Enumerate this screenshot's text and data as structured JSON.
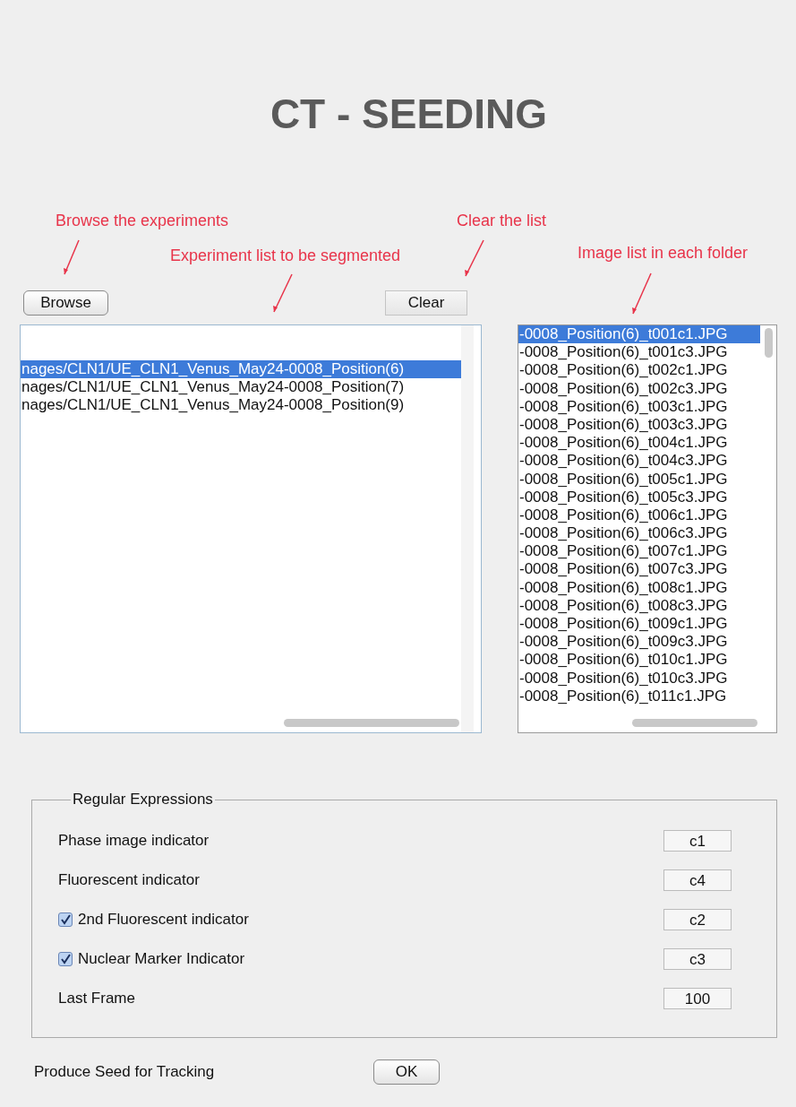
{
  "title": "CT - SEEDING",
  "annotations": [
    {
      "text": "Browse the experiments"
    },
    {
      "text": "Experiment list to be segmented"
    },
    {
      "text": "Clear the list"
    },
    {
      "text": "Image list in each folder"
    }
  ],
  "browse_button": "Browse",
  "clear_button": "Clear",
  "experiment_list": {
    "items": [
      {
        "text": "nages/CLN1/UE_CLN1_Venus_May24-0008_Position(6)",
        "selected": true
      },
      {
        "text": "nages/CLN1/UE_CLN1_Venus_May24-0008_Position(7)",
        "selected": false
      },
      {
        "text": "nages/CLN1/UE_CLN1_Venus_May24-0008_Position(9)",
        "selected": false
      }
    ]
  },
  "image_list": {
    "items": [
      {
        "text": "-0008_Position(6)_t001c1.JPG",
        "selected": true
      },
      {
        "text": "-0008_Position(6)_t001c3.JPG",
        "selected": false
      },
      {
        "text": "-0008_Position(6)_t002c1.JPG",
        "selected": false
      },
      {
        "text": "-0008_Position(6)_t002c3.JPG",
        "selected": false
      },
      {
        "text": "-0008_Position(6)_t003c1.JPG",
        "selected": false
      },
      {
        "text": "-0008_Position(6)_t003c3.JPG",
        "selected": false
      },
      {
        "text": "-0008_Position(6)_t004c1.JPG",
        "selected": false
      },
      {
        "text": "-0008_Position(6)_t004c3.JPG",
        "selected": false
      },
      {
        "text": "-0008_Position(6)_t005c1.JPG",
        "selected": false
      },
      {
        "text": "-0008_Position(6)_t005c3.JPG",
        "selected": false
      },
      {
        "text": "-0008_Position(6)_t006c1.JPG",
        "selected": false
      },
      {
        "text": "-0008_Position(6)_t006c3.JPG",
        "selected": false
      },
      {
        "text": "-0008_Position(6)_t007c1.JPG",
        "selected": false
      },
      {
        "text": "-0008_Position(6)_t007c3.JPG",
        "selected": false
      },
      {
        "text": "-0008_Position(6)_t008c1.JPG",
        "selected": false
      },
      {
        "text": "-0008_Position(6)_t008c3.JPG",
        "selected": false
      },
      {
        "text": "-0008_Position(6)_t009c1.JPG",
        "selected": false
      },
      {
        "text": "-0008_Position(6)_t009c3.JPG",
        "selected": false
      },
      {
        "text": "-0008_Position(6)_t010c1.JPG",
        "selected": false
      },
      {
        "text": "-0008_Position(6)_t010c3.JPG",
        "selected": false
      },
      {
        "text": "-0008_Position(6)_t011c1.JPG",
        "selected": false
      }
    ]
  },
  "regular_expressions": {
    "title": "Regular Expressions",
    "rows": [
      {
        "kind": "plain",
        "label": "Phase image indicator",
        "value": "c1"
      },
      {
        "kind": "plain",
        "label": "Fluorescent indicator",
        "value": "c4"
      },
      {
        "kind": "checkbox",
        "checked": true,
        "label": "2nd Fluorescent indicator",
        "value": "c2"
      },
      {
        "kind": "checkbox",
        "checked": true,
        "label": "Nuclear Marker Indicator",
        "value": "c3"
      },
      {
        "kind": "plain",
        "label": "Last Frame",
        "value": "100"
      }
    ]
  },
  "footer": {
    "label": "Produce Seed for Tracking",
    "button": "OK"
  }
}
